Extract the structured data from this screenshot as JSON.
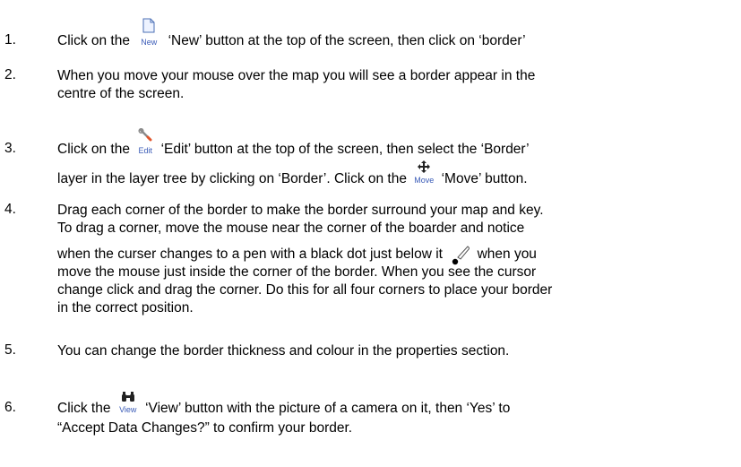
{
  "steps": [
    {
      "number": "1.",
      "a": "Click on the",
      "icon_caption": "New",
      "b": "‘New’ button at the top of the screen, then click on ‘border’"
    },
    {
      "number": "2.",
      "line1": "When you move your mouse over the map you will see a border appear in the",
      "line2": "centre of the screen."
    },
    {
      "number": "3.",
      "a": "Click on the",
      "icon_caption": "Edit",
      "b": "‘Edit’ button at the top of the screen, then select the ‘Border’",
      "line2a": "layer in the layer tree by clicking on ‘Border’. Click on the",
      "move_caption": "Move",
      "line2b": "‘Move’ button."
    },
    {
      "number": "4.",
      "line1": "Drag each corner of the border to make the border surround your map and key.",
      "line2": "To drag a corner, move the mouse near the corner of the boarder and notice",
      "line3a": "when the curser changes to a pen with a black dot just below it",
      "line3b": "when you",
      "line4": "move the mouse just inside the corner of the border. When you see the cursor",
      "line5": "change click and drag the corner. Do this for all four corners to place your border",
      "line6": "in the correct position."
    },
    {
      "number": "5.",
      "line1": "You can change the border thickness and colour in the properties section."
    },
    {
      "number": "6.",
      "a": "Click the",
      "icon_caption": "View",
      "b": "‘View’ button with the picture of a camera on it, then ‘Yes’ to",
      "line2": "“Accept Data Changes?” to confirm your border."
    }
  ],
  "icons": {
    "new": "new-document-icon",
    "edit": "wrench-icon",
    "move": "move-arrows-icon",
    "pen": "pen-cursor-icon",
    "view": "binoculars-icon"
  }
}
